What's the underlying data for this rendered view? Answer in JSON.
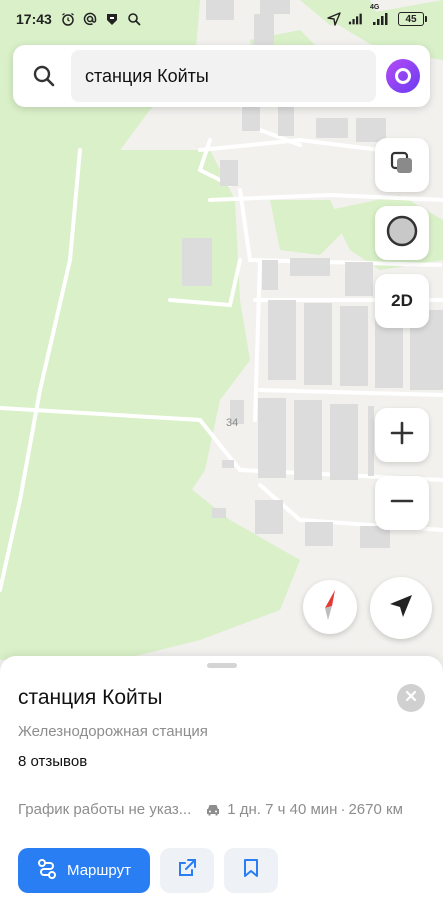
{
  "status_bar": {
    "time": "17:43",
    "network": "4G",
    "battery": "45"
  },
  "search": {
    "query": "станция Койты"
  },
  "map": {
    "house_number": "34",
    "colors": {
      "land": "#f2f1ee",
      "forest": "#d9f0c8",
      "building": "#dcdcdc",
      "road": "#ffffff"
    }
  },
  "controls": {
    "view_mode_label": "2D"
  },
  "place_card": {
    "title": "станция Койты",
    "category": "Железнодорожная станция",
    "reviews": "8 отзывов",
    "hours": "График работы не указ...",
    "route_time": "1 дн. 7 ч 40 мин",
    "distance": "2670 км",
    "route_button": "Маршрут",
    "accent_color": "#2a7ef4"
  }
}
